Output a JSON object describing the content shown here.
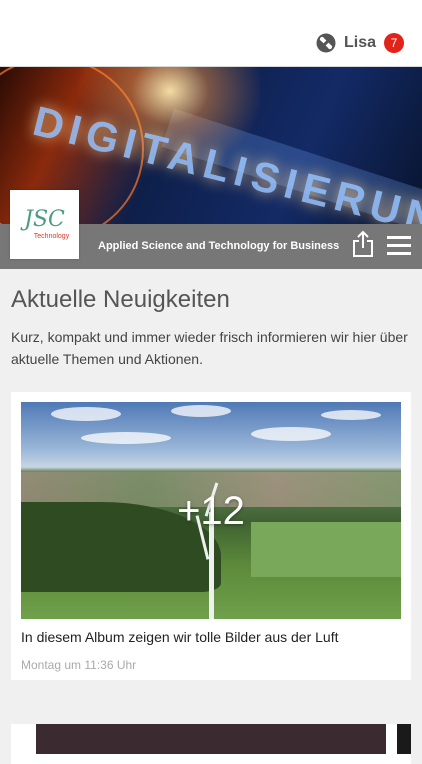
{
  "topbar": {
    "user_name": "Lisa",
    "notification_count": "7"
  },
  "brand": {
    "logo_text": "JSC",
    "logo_subtext": "Technology",
    "tagline": "Applied Science and Technology for Business",
    "hero_word": "DIGITALISIERUNG"
  },
  "news": {
    "heading": "Aktuelle Neuigkeiten",
    "intro": "Kurz, kompakt und immer wieder frisch informieren wir hier über aktuelle Themen und Aktionen.",
    "items": [
      {
        "more_count": "+12",
        "title": "In diesem Album zeigen wir tolle Bilder aus der Luft",
        "time": "Montag um 11:36 Uhr"
      }
    ]
  },
  "colors": {
    "badge": "#e2231a",
    "brandbar": "#777777",
    "logo_green": "#4a9d80",
    "logo_red": "#d23a2a"
  },
  "icons": [
    "app-logo-icon",
    "share-icon",
    "menu-icon"
  ]
}
